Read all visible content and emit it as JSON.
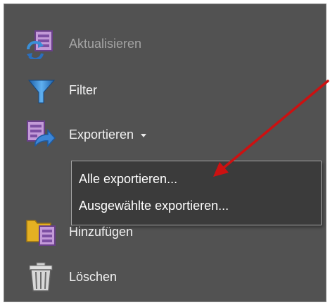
{
  "toolbar": {
    "items": [
      {
        "label": "Aktualisieren",
        "icon": "refresh-document-icon",
        "enabled": false
      },
      {
        "label": "Filter",
        "icon": "funnel-icon",
        "enabled": true
      },
      {
        "label": "Exportieren",
        "icon": "export-document-icon",
        "enabled": true
      },
      {
        "label": "Hinzufügen",
        "icon": "add-folder-icon",
        "enabled": true
      },
      {
        "label": "Löschen",
        "icon": "trash-icon",
        "enabled": true
      }
    ]
  },
  "export_menu": {
    "items": [
      {
        "label": "Alle exportieren..."
      },
      {
        "label": "Ausgewählte exportieren..."
      }
    ]
  },
  "annotation": {
    "color": "#cc1111"
  },
  "colors": {
    "panel_background": "#525252",
    "menu_background": "#3b3b3b",
    "disabled_text": "#a4a4a4"
  }
}
